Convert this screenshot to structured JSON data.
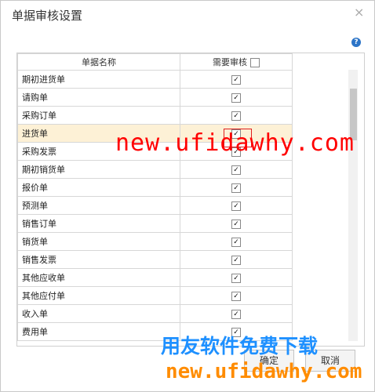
{
  "dialog": {
    "title": "单据审核设置",
    "close_glyph": "×",
    "help_glyph": "?"
  },
  "table": {
    "columns": [
      "单据名称",
      "需要审核"
    ],
    "header_checkbox_checked": false,
    "rows": [
      {
        "name": "期初进货单",
        "checked": true
      },
      {
        "name": "请购单",
        "checked": true
      },
      {
        "name": "采购订单",
        "checked": true
      },
      {
        "name": "进货单",
        "checked": true,
        "selected": true
      },
      {
        "name": "采购发票",
        "checked": true
      },
      {
        "name": "期初销货单",
        "checked": true
      },
      {
        "name": "报价单",
        "checked": true
      },
      {
        "name": "预测单",
        "checked": true
      },
      {
        "name": "销售订单",
        "checked": true
      },
      {
        "name": "销货单",
        "checked": true
      },
      {
        "name": "销售发票",
        "checked": true
      },
      {
        "name": "其他应收单",
        "checked": true
      },
      {
        "name": "其他应付单",
        "checked": true
      },
      {
        "name": "收入单",
        "checked": true
      },
      {
        "name": "费用单",
        "checked": true
      }
    ]
  },
  "buttons": {
    "ok": "确定",
    "cancel": "取消"
  },
  "watermarks": {
    "main": "new.ufidawhy.com",
    "brand": "用友软件免费下载",
    "url": "new.ufidawhy.com"
  },
  "colors": {
    "watermark_red": "#ff0000",
    "watermark_blue": "#1e90ff",
    "watermark_orange": "#ff8c00",
    "selected_row": "#fdf1d6"
  },
  "icons": {
    "help": "help-icon",
    "close": "close-icon",
    "check": "checkbox"
  }
}
